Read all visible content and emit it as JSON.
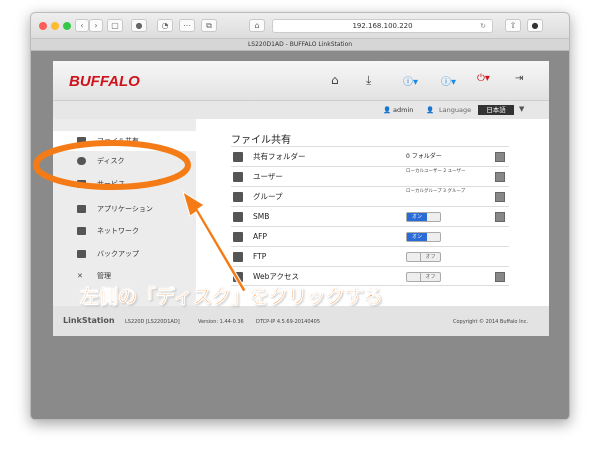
{
  "browser": {
    "url": "192.168.100.220",
    "tab_title": "LS220D1AD - BUFFALO LinkStation"
  },
  "header": {
    "logo": "BUFFALO",
    "user": "admin",
    "language_label": "Language",
    "language_value": "日本語"
  },
  "sidebar": {
    "items": [
      {
        "label": "ファイル共有",
        "active": true
      },
      {
        "label": "ディスク"
      },
      {
        "label": "サービス"
      },
      {
        "label": "アプリケーション"
      },
      {
        "label": "ネットワーク"
      },
      {
        "label": "バックアップ"
      },
      {
        "label": "管理"
      }
    ]
  },
  "main": {
    "title": "ファイル共有",
    "rows": [
      {
        "label": "共有フォルダー",
        "value": "0 フォルダー",
        "edit": true
      },
      {
        "label": "ユーザー",
        "value": "ローカルユーザー 2 ユーザー",
        "edit": true
      },
      {
        "label": "グループ",
        "value": "ローカルグループ 3 グループ",
        "edit": true
      },
      {
        "label": "SMB",
        "toggle": "オン",
        "on": true,
        "edit": true
      },
      {
        "label": "AFP",
        "toggle": "オン",
        "on": true
      },
      {
        "label": "FTP",
        "toggle": "オフ",
        "on": false
      },
      {
        "label": "Webアクセス",
        "toggle": "オフ",
        "on": false,
        "edit": true
      }
    ]
  },
  "footer": {
    "brand": "LinkStation",
    "model": "LS220D [LS220D1AD]",
    "version": "Version: 1.44-0.36",
    "dtcp": "DTCP-IP 4.5.69-20140405",
    "copyright": "Copyright © 2014 Buffalo Inc."
  },
  "annotation": {
    "text": "左側の「ディスク」をクリックする",
    "color": "#f47b16"
  }
}
